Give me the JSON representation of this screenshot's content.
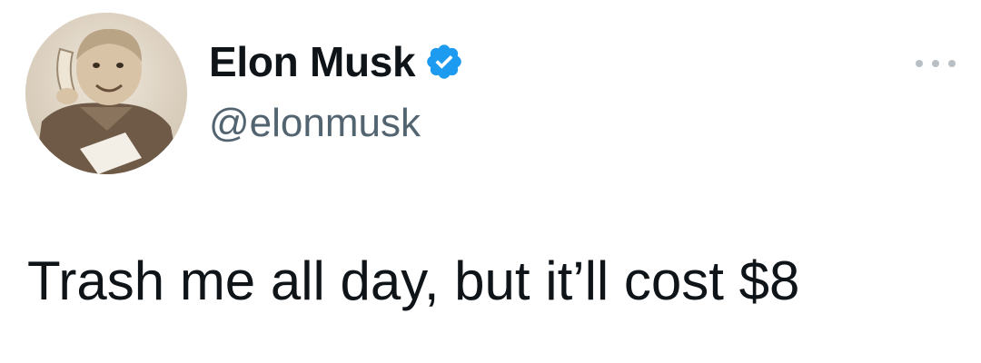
{
  "tweet": {
    "author": {
      "display_name": "Elon Musk",
      "handle": "@elonmusk",
      "verified": true,
      "verified_icon": "verified-badge-icon",
      "verified_color": "#1d9bf0"
    },
    "more_icon": "more-options-icon",
    "text": "Trash me all day, but it’ll cost $8"
  },
  "colors": {
    "text_primary": "#0f1419",
    "text_secondary": "#536471",
    "background": "#ffffff"
  }
}
